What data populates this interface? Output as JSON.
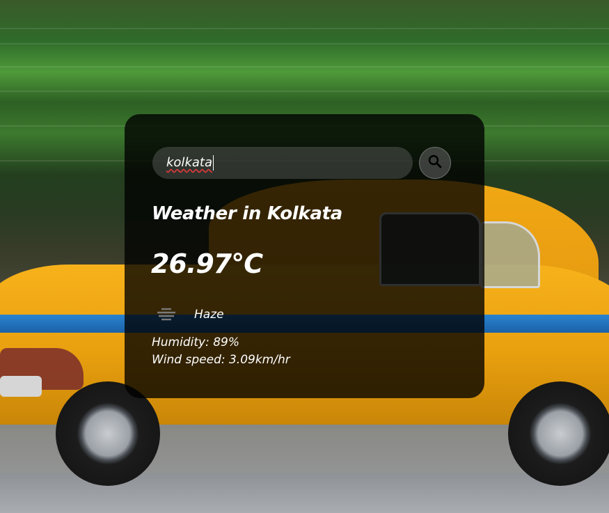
{
  "search": {
    "value": "kolkata",
    "button_icon": "search-icon"
  },
  "weather": {
    "heading": "Weather in Kolkata",
    "temperature": "26.97°C",
    "condition_icon": "haze-icon",
    "condition": "Haze",
    "humidity": "Humidity: 89%",
    "wind": "Wind speed: 3.09km/hr"
  },
  "colors": {
    "card_background": "#000000",
    "text": "#ffffff",
    "taxi_yellow": "#f7b21b",
    "taxi_stripe": "#2a83cf"
  }
}
